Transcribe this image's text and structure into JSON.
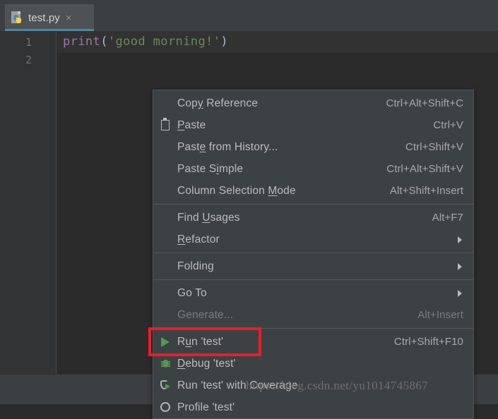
{
  "window": {
    "app": "PyCharm Editor",
    "background_color": "#2b2b2b"
  },
  "tab_bar": {
    "tabs": [
      {
        "label": "test.py",
        "icon": "python-file-icon",
        "close_glyph": "×",
        "active": true,
        "accent_color": "#4a88a8"
      }
    ]
  },
  "editor": {
    "line_numbers": [
      "1",
      "2"
    ],
    "code": {
      "function_name": "print",
      "open_paren": "(",
      "string_literal": "'good morning!'",
      "close_paren": ")"
    },
    "colors": {
      "function": "#9876aa",
      "punctuation": "#a9b7c6",
      "string": "#6a8759",
      "gutter_bg": "#313335",
      "current_line_bg": "#323232"
    }
  },
  "context_menu": {
    "groups": [
      {
        "items": [
          {
            "label": "Copy Reference",
            "shortcut": "Ctrl+Alt+Shift+C",
            "icon": "",
            "mnemonic": "y",
            "submenu": false,
            "disabled": false
          },
          {
            "label": "Paste",
            "shortcut": "Ctrl+V",
            "icon": "clipboard-icon",
            "mnemonic": "P",
            "submenu": false,
            "disabled": false
          },
          {
            "label": "Paste from History...",
            "shortcut": "Ctrl+Shift+V",
            "icon": "",
            "mnemonic": "e",
            "submenu": false,
            "disabled": false
          },
          {
            "label": "Paste Simple",
            "shortcut": "Ctrl+Alt+Shift+V",
            "icon": "",
            "mnemonic": "i",
            "submenu": false,
            "disabled": false
          },
          {
            "label": "Column Selection Mode",
            "shortcut": "Alt+Shift+Insert",
            "icon": "",
            "mnemonic": "M",
            "submenu": false,
            "disabled": false
          }
        ]
      },
      {
        "items": [
          {
            "label": "Find Usages",
            "shortcut": "Alt+F7",
            "icon": "",
            "mnemonic": "U",
            "submenu": false,
            "disabled": false
          },
          {
            "label": "Refactor",
            "shortcut": "",
            "icon": "",
            "mnemonic": "R",
            "submenu": true,
            "disabled": false
          }
        ]
      },
      {
        "items": [
          {
            "label": "Folding",
            "shortcut": "",
            "icon": "",
            "mnemonic": "",
            "submenu": true,
            "disabled": false
          }
        ]
      },
      {
        "items": [
          {
            "label": "Go To",
            "shortcut": "",
            "icon": "",
            "mnemonic": "",
            "submenu": true,
            "disabled": false
          },
          {
            "label": "Generate...",
            "shortcut": "Alt+Insert",
            "icon": "",
            "mnemonic": "",
            "submenu": false,
            "disabled": true
          }
        ]
      },
      {
        "items": [
          {
            "label": "Run 'test'",
            "shortcut": "Ctrl+Shift+F10",
            "icon": "run-play-icon",
            "mnemonic": "u",
            "submenu": false,
            "disabled": false
          },
          {
            "label": "Debug 'test'",
            "shortcut": "",
            "icon": "debug-bug-icon",
            "mnemonic": "D",
            "submenu": false,
            "disabled": false
          },
          {
            "label": "Run 'test' with Coverage",
            "shortcut": "",
            "icon": "coverage-icon",
            "mnemonic": "",
            "submenu": false,
            "disabled": false
          },
          {
            "label": "Profile 'test'",
            "shortcut": "",
            "icon": "profile-icon",
            "mnemonic": "",
            "submenu": false,
            "disabled": false
          }
        ]
      }
    ]
  },
  "annotation": {
    "highlight_target": "Run 'test'",
    "highlight_color": "#ee1c25"
  },
  "watermark": {
    "text": "https://blog.csdn.net/yu1014745867"
  }
}
